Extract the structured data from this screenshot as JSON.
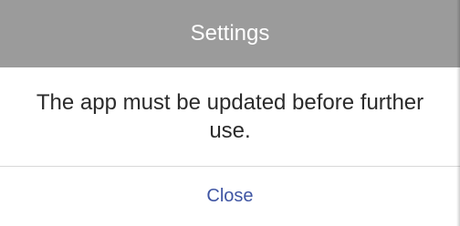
{
  "dialog": {
    "title": "Settings",
    "message": "The app must be updated before further use.",
    "close_label": "Close"
  },
  "colors": {
    "header_bg": "#9b9b9b",
    "header_text": "#ffffff",
    "body_bg": "#ffffff",
    "message_text": "#2b2b2b",
    "action_text": "#3f55a3"
  }
}
